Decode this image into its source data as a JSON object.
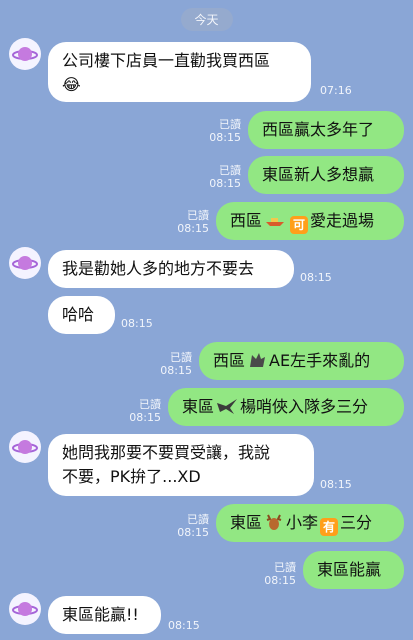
{
  "date_label": "今天",
  "messages": [
    {
      "side": "in",
      "text": "公司樓下店員一直勸我買西區",
      "line2": "😂",
      "time": "07:16"
    },
    {
      "side": "out",
      "text": "西區贏太多年了",
      "read": "已讀",
      "time": "08:15"
    },
    {
      "side": "out",
      "text": "東區新人多想贏",
      "read": "已讀",
      "time": "08:15"
    },
    {
      "side": "out",
      "text_a": "西區",
      "text_b": "可",
      "text_c": "愛走過場",
      "read": "已讀",
      "time": "08:15"
    },
    {
      "side": "in",
      "text": "我是勸她人多的地方不要去",
      "time": "08:15"
    },
    {
      "side": "in",
      "text": "哈哈",
      "time": "08:15"
    },
    {
      "side": "out",
      "text_a": "西區",
      "text_b": "AE左手來亂的",
      "read": "已讀",
      "time": "08:15"
    },
    {
      "side": "out",
      "text_a": "東區",
      "text_b": "楊哨俠入隊多三分",
      "read": "已讀",
      "time": "08:15"
    },
    {
      "side": "in",
      "text": "她問我那要不要買受讓，我說",
      "line2": "不要，PK拚了...XD",
      "time": "08:15"
    },
    {
      "side": "out",
      "text_a": "東區",
      "text_b": "小李",
      "text_c": "有",
      "text_d": "三分",
      "read": "已讀",
      "time": "08:15"
    },
    {
      "side": "out",
      "text": "東區能贏",
      "read": "已讀",
      "time": "08:15"
    },
    {
      "side": "in",
      "text": "東區能贏!!",
      "time": "08:15"
    }
  ]
}
